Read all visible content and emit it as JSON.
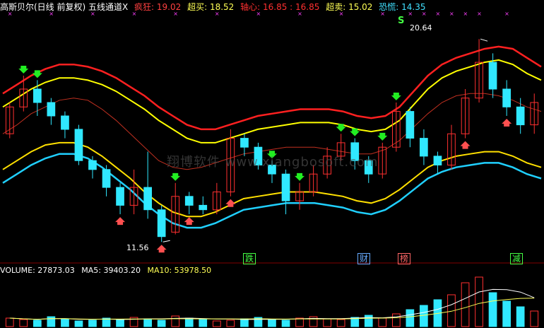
{
  "indicator": {
    "title": "高斯贝尔(日线 前复权) 五线通道X",
    "items": [
      {
        "label": "疯狂: 19.02",
        "color": "#ff4040"
      },
      {
        "label": "超买: 18.52",
        "color": "#ffff55"
      },
      {
        "label": "轴心: 16.85 : 16.85",
        "color": "#ff3030"
      },
      {
        "label": "超卖: 15.02",
        "color": "#ffff55"
      },
      {
        "label": "恐慌: 14.35",
        "color": "#40e0ff"
      }
    ]
  },
  "volume": {
    "label": "VOLUME: 27873.03",
    "ma5": "MA5: 39403.20",
    "ma10": "MA10: 53978.50"
  },
  "annotations": {
    "high": "20.64",
    "low": "11.56",
    "s_mark": "S"
  },
  "tags": [
    {
      "text": "跌",
      "color": "#44ff44"
    },
    {
      "text": "财",
      "color": "#66aaff"
    },
    {
      "text": "榜",
      "color": "#ff6666"
    },
    {
      "text": "减",
      "color": "#44ff44"
    }
  ],
  "watermark": "翔博软件 www.xiangbosoft.com",
  "chart_data": {
    "type": "candlestick",
    "price_range": [
      11.0,
      21.5
    ],
    "high_label": 20.64,
    "low_label": 11.56,
    "series_colors": {
      "crazy": "#ff2020",
      "overbought": "#ffff00",
      "axis": "#c03020",
      "oversold": "#ffe000",
      "panic": "#20d0ff",
      "up": "#ff3030",
      "down": "#30e8ff"
    },
    "bands": {
      "crazy": [
        18.2,
        18.6,
        19.0,
        19.3,
        19.5,
        19.5,
        19.4,
        19.2,
        18.9,
        18.5,
        18.1,
        17.6,
        17.2,
        16.8,
        16.6,
        16.6,
        16.8,
        17.0,
        17.2,
        17.3,
        17.4,
        17.5,
        17.5,
        17.5,
        17.4,
        17.2,
        17.1,
        17.2,
        17.6,
        18.3,
        19.0,
        19.5,
        19.8,
        20.0,
        20.2,
        20.3,
        20.2,
        19.8,
        19.4
      ],
      "overbought": [
        17.6,
        18.0,
        18.4,
        18.7,
        18.9,
        18.9,
        18.8,
        18.6,
        18.3,
        17.9,
        17.5,
        17.0,
        16.6,
        16.2,
        16.0,
        16.0,
        16.2,
        16.4,
        16.6,
        16.7,
        16.8,
        16.9,
        16.9,
        16.9,
        16.8,
        16.6,
        16.5,
        16.6,
        17.0,
        17.7,
        18.4,
        18.9,
        19.2,
        19.4,
        19.6,
        19.7,
        19.5,
        19.1,
        18.8
      ],
      "axis": [
        16.4,
        16.8,
        17.3,
        17.6,
        17.9,
        18.0,
        17.9,
        17.5,
        17.0,
        16.4,
        15.8,
        15.2,
        14.9,
        14.8,
        14.9,
        15.1,
        15.3,
        15.5,
        15.6,
        15.7,
        15.8,
        15.8,
        15.8,
        15.7,
        15.6,
        15.5,
        15.5,
        15.7,
        16.1,
        16.7,
        17.3,
        17.8,
        18.1,
        18.2,
        18.2,
        18.1,
        17.9,
        17.6,
        17.4
      ],
      "oversold": [
        14.8,
        15.2,
        15.6,
        15.9,
        16.0,
        16.0,
        15.8,
        15.4,
        14.9,
        14.4,
        13.8,
        13.3,
        12.9,
        12.7,
        12.7,
        12.9,
        13.2,
        13.5,
        13.6,
        13.7,
        13.8,
        13.8,
        13.8,
        13.7,
        13.6,
        13.4,
        13.3,
        13.5,
        13.9,
        14.4,
        14.9,
        15.2,
        15.4,
        15.5,
        15.6,
        15.6,
        15.4,
        15.1,
        14.9
      ],
      "panic": [
        14.2,
        14.6,
        15.0,
        15.3,
        15.5,
        15.5,
        15.3,
        14.9,
        14.4,
        13.9,
        13.3,
        12.8,
        12.4,
        12.2,
        12.2,
        12.4,
        12.7,
        13.0,
        13.1,
        13.2,
        13.3,
        13.3,
        13.3,
        13.2,
        13.1,
        12.9,
        12.8,
        13.0,
        13.4,
        13.9,
        14.4,
        14.7,
        14.9,
        15.0,
        15.1,
        15.1,
        14.9,
        14.6,
        14.4
      ]
    },
    "candles": [
      [
        16.4,
        17.6,
        17.8,
        16.2
      ],
      [
        17.6,
        18.4,
        19.0,
        17.4
      ],
      [
        18.4,
        17.8,
        18.8,
        17.2
      ],
      [
        17.8,
        17.2,
        18.0,
        16.8
      ],
      [
        17.2,
        16.6,
        17.4,
        16.2
      ],
      [
        16.6,
        15.2,
        16.8,
        15.0
      ],
      [
        15.2,
        14.8,
        15.4,
        14.4
      ],
      [
        14.8,
        14.0,
        15.0,
        13.6
      ],
      [
        14.0,
        13.2,
        14.2,
        12.8
      ],
      [
        13.2,
        14.0,
        14.8,
        12.8
      ],
      [
        14.0,
        13.0,
        15.6,
        12.6
      ],
      [
        13.0,
        11.8,
        13.2,
        11.56
      ],
      [
        12.0,
        13.6,
        14.2,
        11.9
      ],
      [
        13.6,
        13.2,
        13.8,
        12.8
      ],
      [
        13.2,
        13.0,
        13.6,
        12.8
      ],
      [
        13.0,
        13.8,
        14.2,
        12.8
      ],
      [
        13.8,
        16.2,
        16.6,
        13.6
      ],
      [
        16.2,
        15.8,
        16.4,
        15.4
      ],
      [
        15.8,
        15.0,
        16.0,
        14.8
      ],
      [
        15.0,
        14.6,
        15.2,
        14.2
      ],
      [
        14.6,
        13.4,
        14.8,
        12.8
      ],
      [
        13.4,
        13.8,
        14.2,
        13.0
      ],
      [
        13.8,
        14.6,
        15.0,
        13.6
      ],
      [
        14.6,
        15.4,
        15.8,
        14.4
      ],
      [
        15.4,
        16.0,
        16.4,
        15.2
      ],
      [
        16.0,
        15.2,
        16.2,
        14.8
      ],
      [
        15.2,
        14.6,
        15.4,
        14.2
      ],
      [
        14.6,
        15.8,
        16.0,
        14.4
      ],
      [
        15.8,
        17.4,
        17.8,
        15.6
      ],
      [
        17.4,
        16.2,
        17.6,
        15.8
      ],
      [
        16.2,
        15.4,
        16.6,
        15.0
      ],
      [
        15.4,
        15.0,
        15.6,
        14.6
      ],
      [
        15.0,
        16.4,
        16.8,
        14.8
      ],
      [
        16.4,
        18.0,
        18.4,
        16.2
      ],
      [
        18.0,
        19.6,
        20.64,
        17.8
      ],
      [
        19.6,
        18.4,
        20.0,
        18.0
      ],
      [
        18.4,
        17.6,
        18.8,
        17.2
      ],
      [
        17.6,
        16.8,
        18.0,
        16.4
      ],
      [
        16.8,
        17.8,
        18.2,
        16.4
      ]
    ],
    "volume_bars": [
      12,
      10,
      9,
      14,
      11,
      8,
      9,
      12,
      10,
      13,
      11,
      9,
      15,
      12,
      10,
      8,
      9,
      11,
      13,
      10,
      9,
      12,
      14,
      11,
      10,
      13,
      16,
      12,
      18,
      24,
      30,
      38,
      45,
      62,
      70,
      48,
      36,
      28,
      22
    ]
  }
}
